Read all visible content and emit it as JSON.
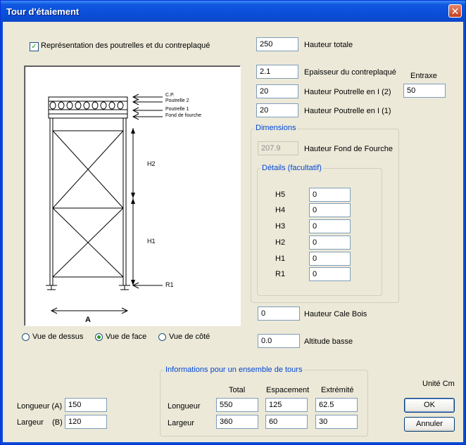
{
  "window": {
    "title": "Tour d'étaiement",
    "close_symbol": "✕"
  },
  "checkbox_repr": {
    "label": "Représentation des poutrelles et du contreplaqué",
    "checked": true
  },
  "diagram": {
    "labels": {
      "cp": "C.P.",
      "poutrelle2": "Poutrelle 2",
      "poutrelle1": "Poutrelle 1",
      "fond": "Fond de fourche",
      "h2": "H2",
      "h1": "H1",
      "r1": "R1",
      "a": "A"
    }
  },
  "views": [
    {
      "label": "Vue de dessus",
      "selected": false
    },
    {
      "label": "Vue de face",
      "selected": true
    },
    {
      "label": "Vue de côté",
      "selected": false
    }
  ],
  "fields": {
    "hauteur_totale": {
      "label": "Hauteur totale",
      "value": "250"
    },
    "epaisseur": {
      "label": "Epaisseur du contreplaqué",
      "value": "2.1"
    },
    "poutrelle2": {
      "label": "Hauteur Poutrelle en I (2)",
      "value": "20"
    },
    "poutrelle1": {
      "label": "Hauteur Poutrelle en I (1)",
      "value": "20"
    },
    "entraxe": {
      "label": "Entraxe",
      "value": "50"
    }
  },
  "dimensions": {
    "title": "Dimensions",
    "fond_fourche": {
      "label": "Hauteur Fond de Fourche",
      "value": "207.9"
    },
    "details": {
      "title": "Détails (facultatif)",
      "rows": [
        {
          "label": "H5",
          "value": "0"
        },
        {
          "label": "H4",
          "value": "0"
        },
        {
          "label": "H3",
          "value": "0"
        },
        {
          "label": "H2",
          "value": "0"
        },
        {
          "label": "H1",
          "value": "0"
        },
        {
          "label": "R1",
          "value": "0"
        }
      ]
    }
  },
  "cale_bois": {
    "label": "Hauteur Cale Bois",
    "value": "0"
  },
  "altitude": {
    "label": "Altitude basse",
    "value": "0.0"
  },
  "dims_left": {
    "longueur": {
      "label": "Longueur (A)",
      "value": "150"
    },
    "largeur": {
      "label": "Largeur    (B)",
      "value": "120"
    }
  },
  "ensemble": {
    "title": "Informations pour un ensemble de tours",
    "headers": [
      "Total",
      "Espacement",
      "Extrémité"
    ],
    "rows": [
      {
        "label": "Longueur",
        "values": [
          "550",
          "125",
          "62.5"
        ]
      },
      {
        "label": "Largeur",
        "values": [
          "360",
          "60",
          "30"
        ]
      }
    ]
  },
  "unit": "Unité Cm",
  "buttons": {
    "ok": "OK",
    "cancel": "Annuler"
  }
}
